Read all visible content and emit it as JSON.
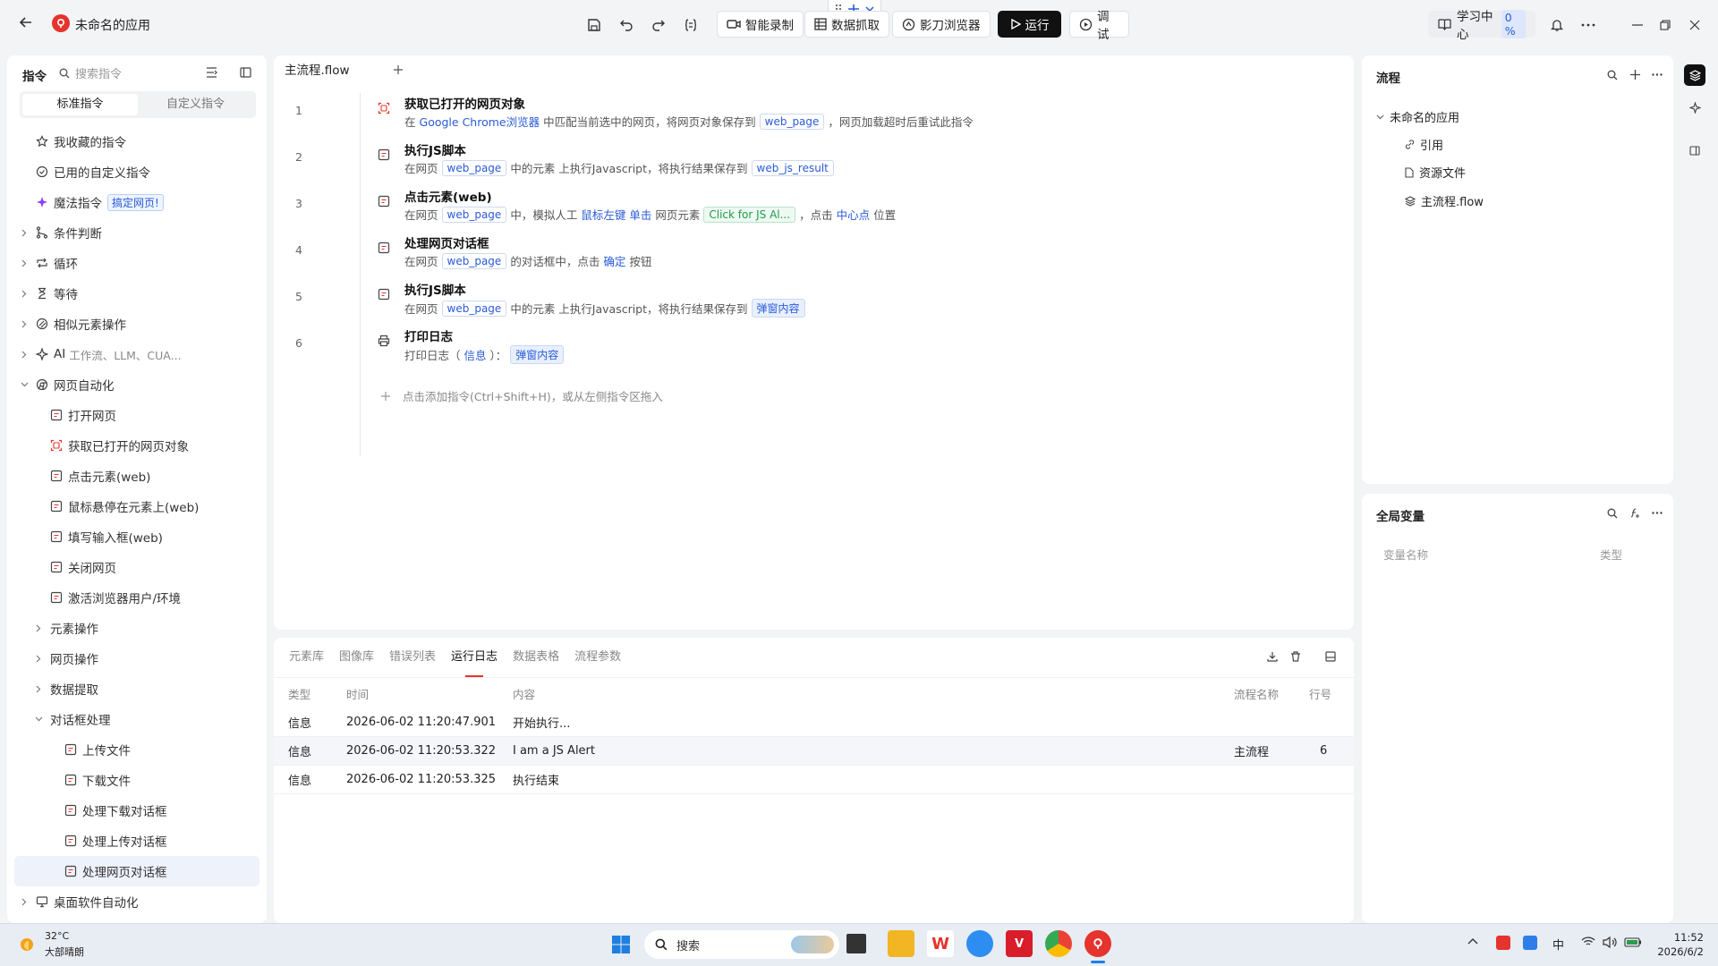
{
  "app": {
    "title": "未命名的应用"
  },
  "toolbar": {
    "smart_record": "智能录制",
    "data_capture": "数据抓取",
    "browser": "影刀浏览器",
    "run": "运行",
    "debug": "调试",
    "learning": "学习中心",
    "learning_progress": "0 %"
  },
  "left": {
    "tab_commands": "指令",
    "search_placeholder": "搜索指令",
    "seg_standard": "标准指令",
    "seg_custom": "自定义指令",
    "items": [
      {
        "label": "我收藏的指令",
        "icon": "star-icon"
      },
      {
        "label": "已用的自定义指令",
        "icon": "check-circle-icon"
      },
      {
        "label": "魔法指令",
        "icon": "sparkle-icon",
        "badge": "搞定网页!"
      },
      {
        "label": "条件判断",
        "icon": "branch-icon"
      },
      {
        "label": "循环",
        "icon": "loop-icon"
      },
      {
        "label": "等待",
        "icon": "hourglass-icon"
      },
      {
        "label": "相似元素操作",
        "icon": "similar-icon"
      },
      {
        "label": "AI",
        "sub": "工作流、LLM、CUA...",
        "icon": "ai-icon"
      },
      {
        "label": "网页自动化",
        "icon": "chrome-icon"
      },
      {
        "label": "打开网页",
        "icon": "web-open-icon"
      },
      {
        "label": "获取已打开的网页对象",
        "icon": "web-get-icon"
      },
      {
        "label": "点击元素(web)",
        "icon": "web-click-icon"
      },
      {
        "label": "鼠标悬停在元素上(web)",
        "icon": "web-hover-icon"
      },
      {
        "label": "填写输入框(web)",
        "icon": "web-input-icon"
      },
      {
        "label": "关闭网页",
        "icon": "web-close-icon"
      },
      {
        "label": "激活浏览器用户/环境",
        "icon": "web-activate-icon"
      },
      {
        "label": "元素操作"
      },
      {
        "label": "网页操作"
      },
      {
        "label": "数据提取"
      },
      {
        "label": "对话框处理"
      },
      {
        "label": "上传文件",
        "icon": "upload-file-icon"
      },
      {
        "label": "下载文件",
        "icon": "download-file-icon"
      },
      {
        "label": "处理下载对话框",
        "icon": "dialog-download-icon"
      },
      {
        "label": "处理上传对话框",
        "icon": "dialog-upload-icon"
      },
      {
        "label": "处理网页对话框",
        "icon": "dialog-web-icon"
      },
      {
        "label": "桌面软件自动化",
        "icon": "desktop-icon"
      }
    ]
  },
  "editor": {
    "tab": "主流程.flow",
    "steps": [
      {
        "num": "1",
        "title": "获取已打开的网页对象",
        "d": [
          "在",
          "Google Chrome浏览器",
          "中匹配当前选中的网页，将网页对象保存到",
          "web_page",
          "，网页加载超时后重试此指令"
        ]
      },
      {
        "num": "2",
        "title": "执行JS脚本",
        "d": [
          "在网页",
          "web_page",
          "中的元素 上执行Javascript，将执行结果保存到",
          "web_js_result"
        ]
      },
      {
        "num": "3",
        "title": "点击元素(web)",
        "d": [
          "在网页",
          "web_page",
          "中，模拟人工",
          "鼠标左键",
          "单击",
          "网页元素",
          "Click for JS Al...",
          "，点击",
          "中心点",
          "位置"
        ]
      },
      {
        "num": "4",
        "title": "处理网页对话框",
        "d": [
          "在网页",
          "web_page",
          "的对话框中，点击",
          "确定",
          "按钮"
        ]
      },
      {
        "num": "5",
        "title": "执行JS脚本",
        "d": [
          "在网页",
          "web_page",
          "中的元素 上执行Javascript，将执行结果保存到",
          "弹窗内容"
        ]
      },
      {
        "num": "6",
        "title": "打印日志",
        "d": [
          "打印日志（",
          "信息",
          "）：",
          "弹窗内容"
        ]
      }
    ],
    "add_hint": "点击添加指令(Ctrl+Shift+H)，或从左侧指令区拖入"
  },
  "bottom": {
    "tabs": [
      "元素库",
      "图像库",
      "错误列表",
      "运行日志",
      "数据表格",
      "流程参数"
    ],
    "active_tab": "运行日志",
    "headers": {
      "type": "类型",
      "time": "时间",
      "content": "内容",
      "flow": "流程名称",
      "line": "行号"
    },
    "rows": [
      {
        "type": "信息",
        "time": "2026-06-02 11:20:47.901",
        "content": "开始执行...",
        "flow": "",
        "line": ""
      },
      {
        "type": "信息",
        "time": "2026-06-02 11:20:53.322",
        "content": "I am a JS Alert",
        "flow": "主流程",
        "line": "6"
      },
      {
        "type": "信息",
        "time": "2026-06-02 11:20:53.325",
        "content": "执行结束",
        "flow": "",
        "line": ""
      }
    ]
  },
  "right": {
    "flow_title": "流程",
    "tree": {
      "root": "未命名的应用",
      "children": [
        "引用",
        "资源文件",
        "主流程.flow"
      ]
    },
    "vars_title": "全局变量",
    "var_name_header": "变量名称",
    "var_type_header": "类型"
  },
  "taskbar": {
    "weather_temp": "32°C",
    "weather_desc": "大部晴朗",
    "search_placeholder": "搜索",
    "ime": "中",
    "time": "11:52",
    "date": "2026/6/2"
  },
  "colors": {
    "accent": "#e5332d",
    "link": "#2a5bd7",
    "run_bg": "#111111"
  }
}
